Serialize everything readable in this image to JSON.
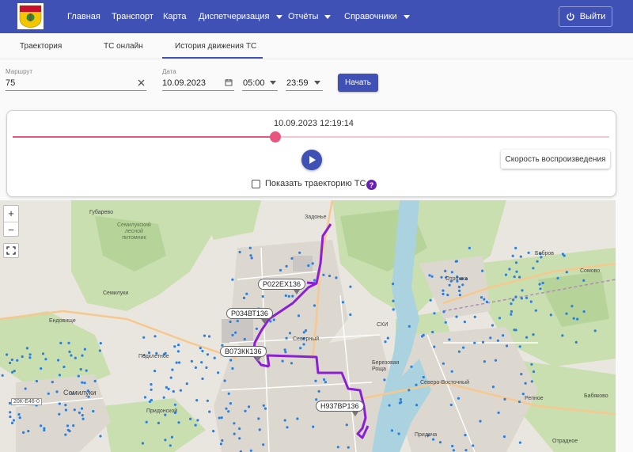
{
  "header": {
    "nav": [
      {
        "label": "Главная",
        "dropdown": false
      },
      {
        "label": "Транспорт",
        "dropdown": false
      },
      {
        "label": "Карта",
        "dropdown": false
      },
      {
        "label": "Диспетчеризация",
        "dropdown": true
      },
      {
        "label": "Отчёты",
        "dropdown": true
      },
      {
        "label": "Справочники",
        "dropdown": true
      }
    ],
    "logout_label": "Выйти"
  },
  "tabs": [
    {
      "label": "Траектория",
      "active": false
    },
    {
      "label": "ТС онлайн",
      "active": false
    },
    {
      "label": "История движения ТС",
      "active": true
    }
  ],
  "form": {
    "route_label": "Маршрут",
    "route_value": "75",
    "date_label": "Дата",
    "date_value": "10.09.2023",
    "time_from": "05:00",
    "time_to": "23:59",
    "start_label": "Начать"
  },
  "player": {
    "timestamp": "10.09.2023 12:19:14",
    "progress": 0.44,
    "speed_label": "Скорость воспроизведения",
    "show_trajectory_label": "Показать траекторию ТС",
    "show_trajectory_checked": false,
    "help_glyph": "?"
  },
  "map": {
    "zoom_in": "+",
    "zoom_out": "−",
    "place_labels": [
      {
        "text": "Губарево",
        "big": false
      },
      {
        "text": "Семилукский\nлесной\nпитомник",
        "big": false
      },
      {
        "text": "Семилуки",
        "big": false
      },
      {
        "text": "Ендовище",
        "big": false
      },
      {
        "text": "Подклетное",
        "big": false
      },
      {
        "text": "Семилуки",
        "big": true
      },
      {
        "text": "20К-Е46-0",
        "big": false
      },
      {
        "text": "Задонье",
        "big": false
      },
      {
        "text": "Отрожка",
        "big": false
      },
      {
        "text": "Бобров",
        "big": false
      },
      {
        "text": "Сомово",
        "big": false
      },
      {
        "text": "Северный",
        "big": false
      },
      {
        "text": "Березовая\nРоща",
        "big": false
      },
      {
        "text": "Северо-Восточный",
        "big": false
      },
      {
        "text": "Репное",
        "big": false
      },
      {
        "text": "Бабяково",
        "big": false
      },
      {
        "text": "Придонской",
        "big": false
      },
      {
        "text": "Отрадное",
        "big": false
      },
      {
        "text": "СХИ",
        "big": false
      },
      {
        "text": "Придача",
        "big": false
      }
    ],
    "vehicles": [
      "Р022ЕХ136",
      "Р034ВТ136",
      "В073КК136",
      "Н937ВР136"
    ]
  },
  "colors": {
    "header": "#3f51b5",
    "accent": "#e8557e",
    "track": "#8a1fd6",
    "stops": "#2a7fe0"
  }
}
